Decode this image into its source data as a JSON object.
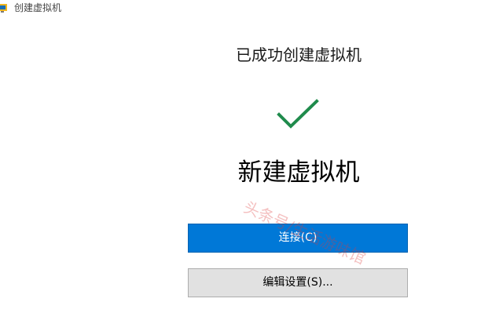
{
  "window": {
    "title": "创建虚拟机",
    "icon": "hyper-v-app-icon"
  },
  "main": {
    "heading": "已成功创建虚拟机",
    "status_icon": "checkmark-icon",
    "status_color": "#1f8b4c",
    "vm_name": "新建虚拟机"
  },
  "buttons": {
    "connect_label": "连接(C)",
    "edit_settings_label": "编辑设置(S)..."
  },
  "colors": {
    "primary_button": "#0078d7",
    "secondary_button": "#e1e1e1"
  },
  "watermark": {
    "text": "头条号/生活游味馆"
  }
}
